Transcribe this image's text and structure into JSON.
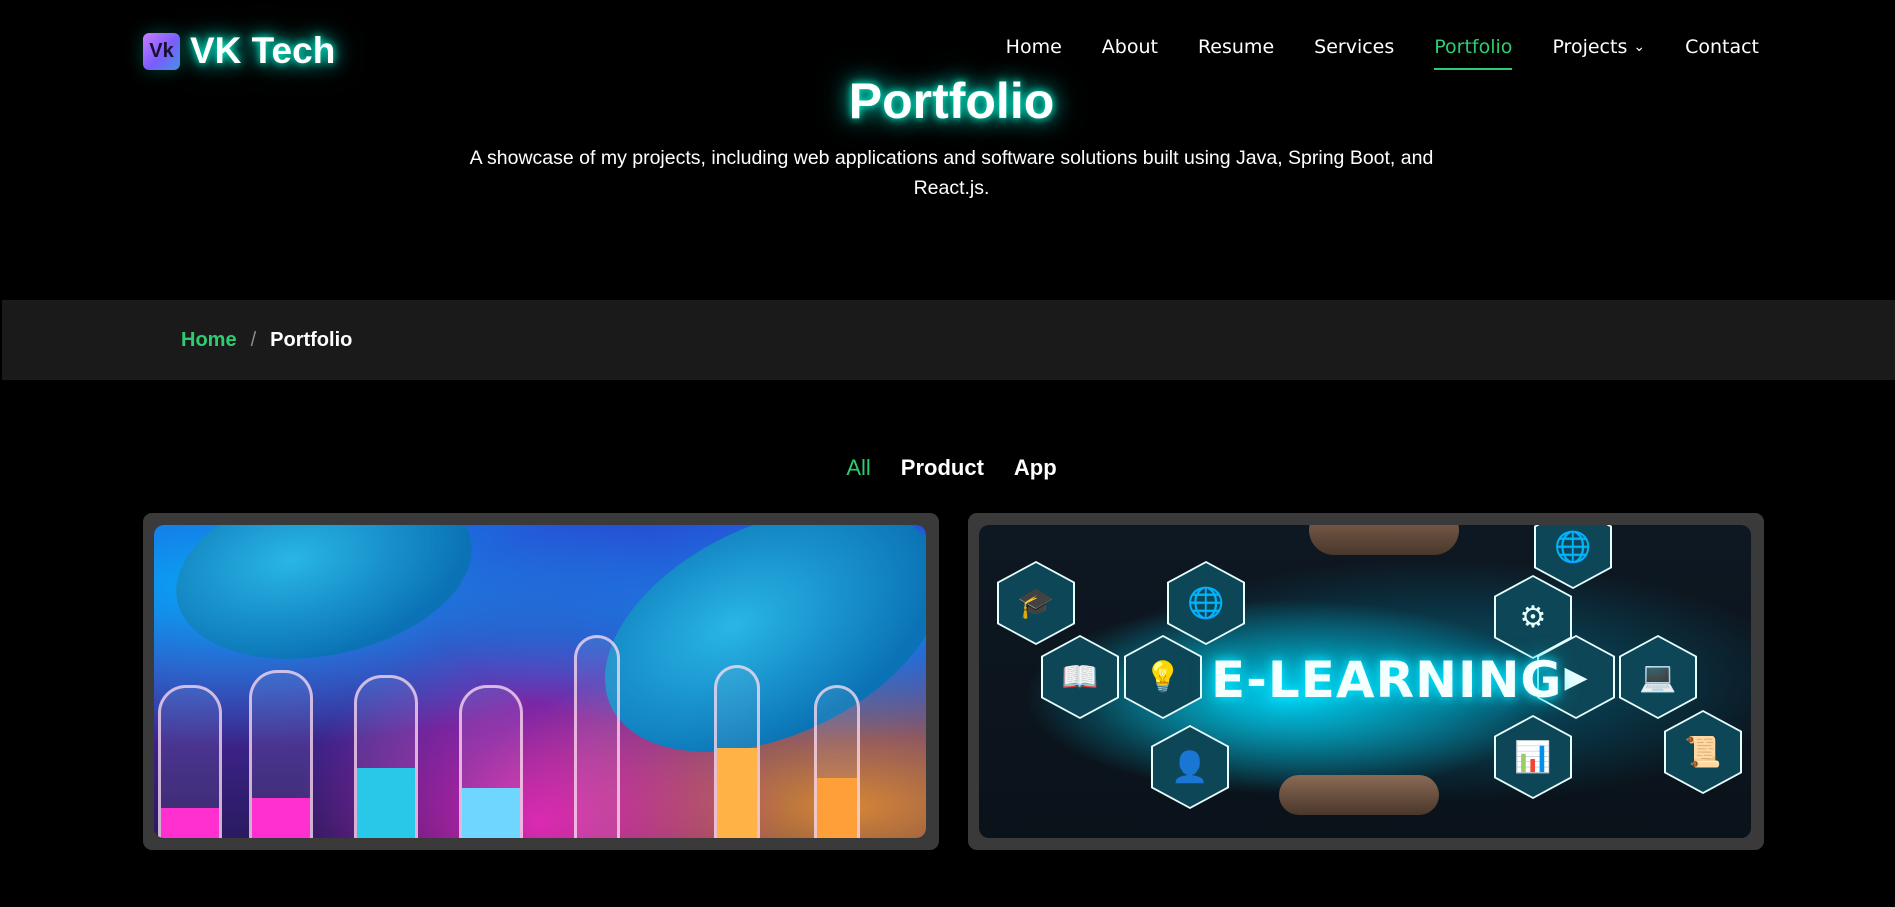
{
  "brand": {
    "badge": "Vk",
    "name": "VK Tech"
  },
  "nav": {
    "items": [
      {
        "label": "Home",
        "active": false
      },
      {
        "label": "About",
        "active": false
      },
      {
        "label": "Resume",
        "active": false
      },
      {
        "label": "Services",
        "active": false
      },
      {
        "label": "Portfolio",
        "active": true
      },
      {
        "label": "Projects",
        "active": false,
        "dropdown": true
      },
      {
        "label": "Contact",
        "active": false
      }
    ]
  },
  "hero": {
    "title": "Portfolio",
    "subtitle": "A showcase of my projects, including web applications and software solutions built using Java, Spring Boot, and React.js."
  },
  "breadcrumb": {
    "home": "Home",
    "separator": "/",
    "current": "Portfolio"
  },
  "filters": [
    {
      "label": "All",
      "active": true
    },
    {
      "label": "Product",
      "active": false
    },
    {
      "label": "App",
      "active": false
    }
  ],
  "cards": [
    {
      "image_subject": "laboratory test tubes"
    },
    {
      "image_subject": "e-learning",
      "image_text": "E-LEARNING"
    }
  ],
  "colors": {
    "accent": "#2ecc71",
    "glow": "#00ffd5",
    "bar": "#1a1a1a",
    "card": "#3a3a3a"
  }
}
